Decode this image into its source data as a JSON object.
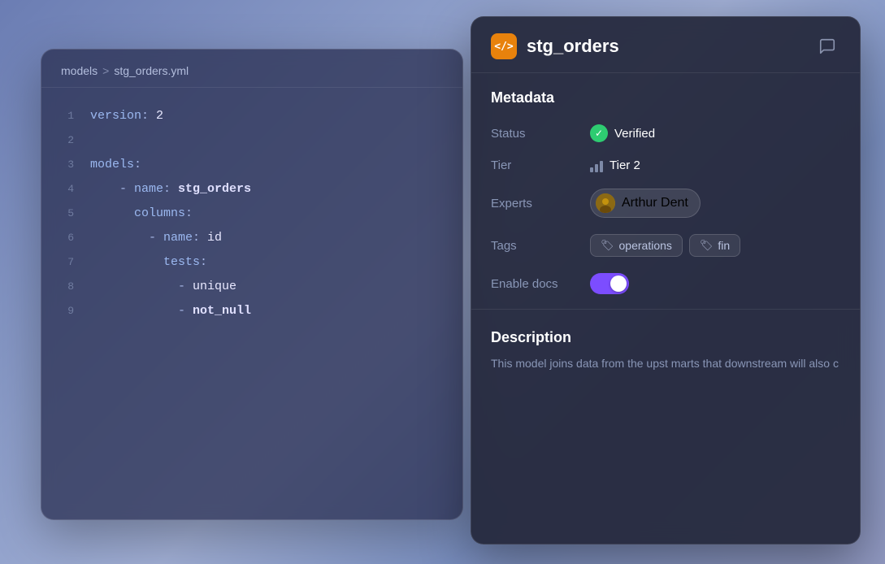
{
  "codepanel": {
    "breadcrumb": {
      "part1": "models",
      "separator": ">",
      "part2": "stg_orders.yml"
    },
    "lines": [
      {
        "num": "1",
        "code": "version: 2",
        "tokens": [
          {
            "text": "version",
            "class": "kw-key"
          },
          {
            "text": ": ",
            "class": ""
          },
          {
            "text": "2",
            "class": "kw-num"
          }
        ]
      },
      {
        "num": "2",
        "code": "",
        "tokens": []
      },
      {
        "num": "3",
        "code": "models:",
        "tokens": [
          {
            "text": "models",
            "class": "kw-key"
          },
          {
            "text": ":",
            "class": ""
          }
        ]
      },
      {
        "num": "4",
        "code": "    - name: stg_orders",
        "tokens": [
          {
            "text": "    - ",
            "class": "kw-dash"
          },
          {
            "text": "name",
            "class": "kw-key"
          },
          {
            "text": ": ",
            "class": ""
          },
          {
            "text": "stg_orders",
            "class": "kw-monospace"
          }
        ]
      },
      {
        "num": "5",
        "code": "      columns:",
        "tokens": [
          {
            "text": "      ",
            "class": ""
          },
          {
            "text": "columns",
            "class": "kw-key"
          },
          {
            "text": ":",
            "class": ""
          }
        ]
      },
      {
        "num": "6",
        "code": "        - name: id",
        "tokens": [
          {
            "text": "        - ",
            "class": "kw-dash"
          },
          {
            "text": "name",
            "class": "kw-key"
          },
          {
            "text": ": ",
            "class": ""
          },
          {
            "text": "id",
            "class": "kw-val"
          }
        ]
      },
      {
        "num": "7",
        "code": "          tests:",
        "tokens": [
          {
            "text": "          ",
            "class": ""
          },
          {
            "text": "tests",
            "class": "kw-key"
          },
          {
            "text": ":",
            "class": ""
          }
        ]
      },
      {
        "num": "8",
        "code": "            - unique",
        "tokens": [
          {
            "text": "            - ",
            "class": "kw-dash"
          },
          {
            "text": "unique",
            "class": "kw-val"
          }
        ]
      },
      {
        "num": "9",
        "code": "            - not_null",
        "tokens": [
          {
            "text": "            - ",
            "class": "kw-dash"
          },
          {
            "text": "not_null",
            "class": "kw-monospace"
          }
        ]
      }
    ]
  },
  "metapanel": {
    "model_icon_label": "</>",
    "title": "stg_orders",
    "metadata_section": "Metadata",
    "status_label": "Status",
    "status_value": "Verified",
    "tier_label": "Tier",
    "tier_value": "Tier 2",
    "experts_label": "Experts",
    "expert_name": "Arthur Dent",
    "tags_label": "Tags",
    "tags": [
      {
        "label": "operations"
      },
      {
        "label": "fin"
      }
    ],
    "enable_docs_label": "Enable docs",
    "description_title": "Description",
    "description_text": "This model joins data from the upst\nmarts that downstream will also c"
  },
  "colors": {
    "accent_purple": "#7c4dff",
    "verified_green": "#2ecc71",
    "model_icon_bg": "#e8820c"
  }
}
